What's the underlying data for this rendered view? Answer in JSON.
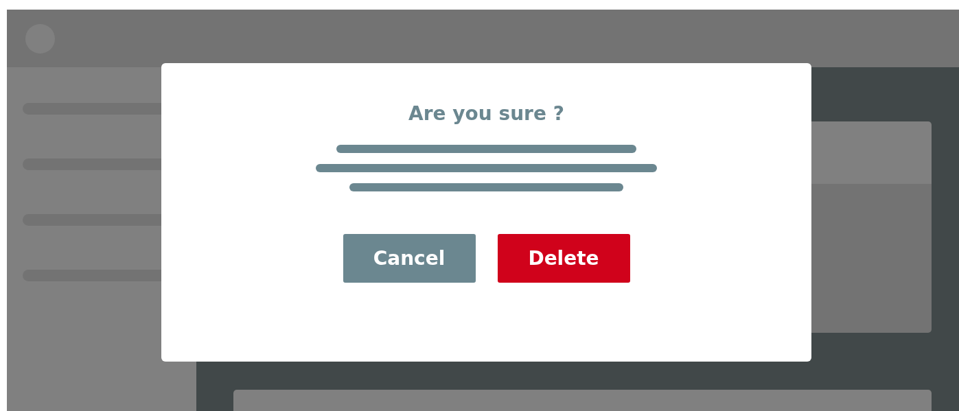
{
  "dialog": {
    "title": "Are you sure ?",
    "buttons": [
      {
        "label": "Cancel",
        "kind": "secondary"
      },
      {
        "label": "Delete",
        "kind": "danger"
      }
    ]
  }
}
